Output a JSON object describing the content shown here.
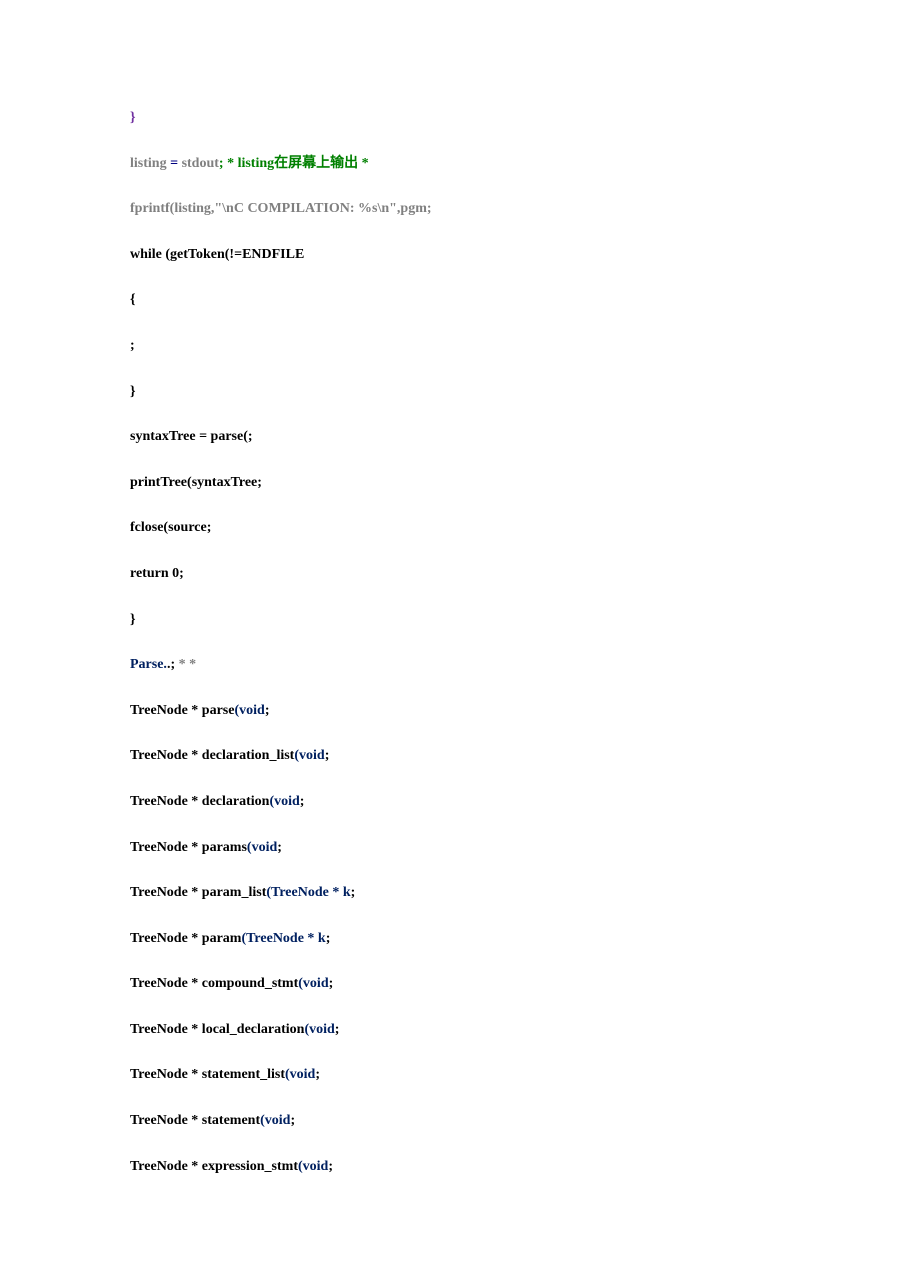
{
  "lines": [
    {
      "segments": [
        {
          "text": "}",
          "cls": "purple"
        }
      ]
    },
    {
      "segments": [
        {
          "text": "listing ",
          "cls": "gray"
        },
        {
          "text": "= ",
          "cls": "navy"
        },
        {
          "text": "stdout",
          "cls": "gray"
        },
        {
          "text": "; * listing在屏幕上输出 *",
          "cls": "green"
        }
      ]
    },
    {
      "segments": [
        {
          "text": "fprintf(listing,\"\\nC COMPILATION: %s\\n\",pgm;",
          "cls": "gray"
        }
      ]
    },
    {
      "segments": [
        {
          "text": "while (getToken(!=ENDFILE",
          "cls": "black"
        }
      ]
    },
    {
      "segments": [
        {
          "text": "{",
          "cls": "black"
        }
      ]
    },
    {
      "segments": [
        {
          "text": ";",
          "cls": "black"
        }
      ]
    },
    {
      "segments": [
        {
          "text": "}",
          "cls": "black"
        }
      ]
    },
    {
      "segments": [
        {
          "text": "syntaxTree = parse(;",
          "cls": "black"
        }
      ]
    },
    {
      "segments": [
        {
          "text": "printTree(syntaxTree;",
          "cls": "black"
        }
      ]
    },
    {
      "segments": [
        {
          "text": "fclose(source;",
          "cls": "black"
        }
      ]
    },
    {
      "segments": [
        {
          "text": "return 0;",
          "cls": "black"
        }
      ]
    },
    {
      "segments": [
        {
          "text": "}",
          "cls": "black"
        }
      ]
    },
    {
      "segments": [
        {
          "text": "Parse.",
          "cls": "blue"
        },
        {
          "text": ".; ",
          "cls": "black"
        },
        {
          "text": "* *",
          "cls": "gray"
        }
      ]
    },
    {
      "segments": [
        {
          "text": "TreeNode * parse",
          "cls": "black"
        },
        {
          "text": "(void",
          "cls": "blue"
        },
        {
          "text": ";",
          "cls": "black"
        }
      ]
    },
    {
      "segments": [
        {
          "text": "TreeNode * declaration_list",
          "cls": "black"
        },
        {
          "text": "(void",
          "cls": "blue"
        },
        {
          "text": ";",
          "cls": "black"
        }
      ]
    },
    {
      "segments": [
        {
          "text": "TreeNode * declaration",
          "cls": "black"
        },
        {
          "text": "(void",
          "cls": "blue"
        },
        {
          "text": ";",
          "cls": "black"
        }
      ]
    },
    {
      "segments": [
        {
          "text": "TreeNode * params",
          "cls": "black"
        },
        {
          "text": "(void",
          "cls": "blue"
        },
        {
          "text": ";",
          "cls": "black"
        }
      ]
    },
    {
      "segments": [
        {
          "text": "TreeNode * param_list",
          "cls": "black"
        },
        {
          "text": "(TreeNode * k",
          "cls": "blue"
        },
        {
          "text": ";",
          "cls": "black"
        }
      ]
    },
    {
      "segments": [
        {
          "text": "TreeNode * param",
          "cls": "black"
        },
        {
          "text": "(TreeNode * k",
          "cls": "blue"
        },
        {
          "text": ";",
          "cls": "black"
        }
      ]
    },
    {
      "segments": [
        {
          "text": "TreeNode * compound_stmt",
          "cls": "black"
        },
        {
          "text": "(void",
          "cls": "blue"
        },
        {
          "text": ";",
          "cls": "black"
        }
      ]
    },
    {
      "segments": [
        {
          "text": "TreeNode * local_declaration",
          "cls": "black"
        },
        {
          "text": "(void",
          "cls": "blue"
        },
        {
          "text": ";",
          "cls": "black"
        }
      ]
    },
    {
      "segments": [
        {
          "text": "TreeNode * statement_list",
          "cls": "black"
        },
        {
          "text": "(void",
          "cls": "blue"
        },
        {
          "text": ";",
          "cls": "black"
        }
      ]
    },
    {
      "segments": [
        {
          "text": "TreeNode * statement",
          "cls": "black"
        },
        {
          "text": "(void",
          "cls": "blue"
        },
        {
          "text": ";",
          "cls": "black"
        }
      ]
    },
    {
      "segments": [
        {
          "text": "TreeNode * expression_stmt",
          "cls": "black"
        },
        {
          "text": "(void",
          "cls": "blue"
        },
        {
          "text": ";",
          "cls": "black"
        }
      ]
    }
  ]
}
